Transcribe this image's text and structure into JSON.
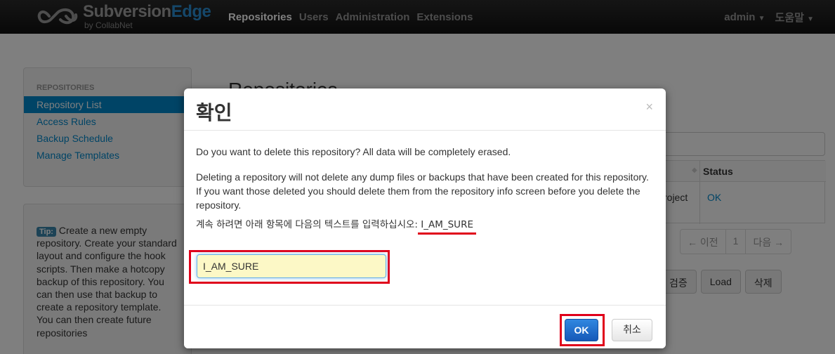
{
  "topnav": {
    "brand": {
      "part1": "Subversion",
      "part2": "Edge",
      "sub": "by CollabNet"
    },
    "items": [
      {
        "label": "Repositories",
        "active": true
      },
      {
        "label": "Users",
        "active": false
      },
      {
        "label": "Administration",
        "active": false
      },
      {
        "label": "Extensions",
        "active": false
      }
    ],
    "user_menu": "admin",
    "help_menu": "도움말"
  },
  "sidebar": {
    "header": "REPOSITORIES",
    "items": [
      {
        "label": "Repository List",
        "active": true
      },
      {
        "label": "Access Rules"
      },
      {
        "label": "Backup Schedule"
      },
      {
        "label": "Manage Templates"
      }
    ]
  },
  "tip": {
    "label": "Tip:",
    "text": "Create a new empty repository. Create your standard layout and configure the hook scripts. Then make a hotcopy backup of this repository. You can then use that backup to create a repository template. You can then create future repositories"
  },
  "background": {
    "heading": "Repositories",
    "table": {
      "status_header": "Status",
      "row_name": "roject",
      "row_status": "OK"
    },
    "pager": {
      "prev": "← 이전",
      "page": "1",
      "next": "다음 →"
    },
    "actions": [
      "검증",
      "Load",
      "삭제"
    ]
  },
  "modal": {
    "title": "확인",
    "close": "×",
    "p1": "Do you want to delete this repository? All data will be completely erased.",
    "p2": "Deleting a repository will not delete any dump files or backups that have been created for this repository. If you want those deleted you should delete them from the repository info screen before you delete the repository.",
    "p3_prefix": "계속 하려면 아래 항목에 다음의 텍스트를 입력하십시오: ",
    "p3_token": "I_AM_SURE",
    "input_value": "I_AM_SURE",
    "ok_label": "OK",
    "cancel_label": "취소"
  },
  "colors": {
    "nav_bg": "#1a1a1a",
    "link": "#0088cc",
    "highlight": "#e0001a",
    "primary_button": "#1f6ed4",
    "input_bg": "#fcf8c6"
  }
}
